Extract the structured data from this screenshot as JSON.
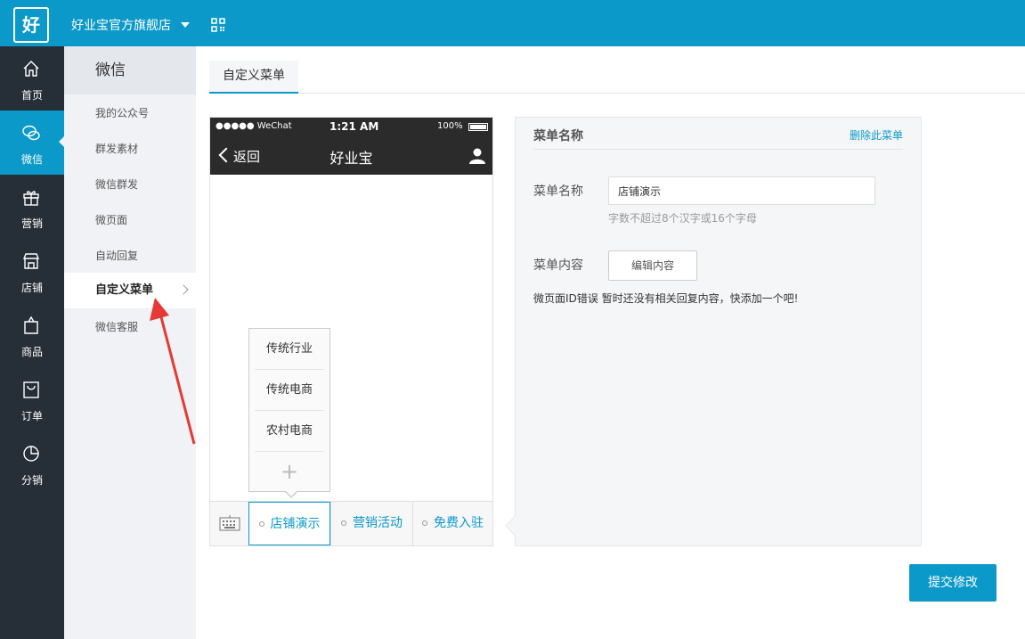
{
  "topbar": {
    "logo": "好",
    "shop_name": "好业宝官方旗舰店",
    "qr_icon": "qrcode-icon"
  },
  "left_nav": [
    {
      "label": "首页",
      "icon": "home-icon",
      "active": false
    },
    {
      "label": "微信",
      "icon": "wechat-icon",
      "active": true
    },
    {
      "label": "营销",
      "icon": "gift-icon",
      "active": false
    },
    {
      "label": "店铺",
      "icon": "store-icon",
      "active": false
    },
    {
      "label": "商品",
      "icon": "bag-icon",
      "active": false
    },
    {
      "label": "订单",
      "icon": "order-icon",
      "active": false
    },
    {
      "label": "分销",
      "icon": "pie-chart-icon",
      "active": false
    }
  ],
  "sub_nav": {
    "title": "微信",
    "items": [
      {
        "label": "我的公众号",
        "active": false
      },
      {
        "label": "群发素材",
        "active": false
      },
      {
        "label": "微信群发",
        "active": false
      },
      {
        "label": "微页面",
        "active": false
      },
      {
        "label": "自动回复",
        "active": false
      },
      {
        "label": "自定义菜单",
        "active": true
      },
      {
        "label": "微信客服",
        "active": false
      }
    ]
  },
  "tabs": [
    {
      "label": "自定义菜单",
      "active": true
    }
  ],
  "phone": {
    "carrier": "●●●●● WeChat",
    "time": "1:21 AM",
    "battery": "100%",
    "back_label": "返回",
    "title": "好业宝",
    "submenu": [
      "传统行业",
      "传统电商",
      "农村电商"
    ],
    "submenu_add": "+",
    "menu": [
      {
        "label": "店铺演示",
        "active": true
      },
      {
        "label": "营销活动",
        "active": false
      },
      {
        "label": "免费入驻",
        "active": false
      }
    ]
  },
  "panel": {
    "title": "菜单名称",
    "delete_link": "删除此菜单",
    "name_label": "菜单名称",
    "name_value": "店铺演示",
    "hint": "字数不超过8个汉字或16个字母",
    "content_label": "菜单内容",
    "edit_button": "编辑内容",
    "error_text": "微页面ID错误 暂时还没有相关回复内容，快添加一个吧!"
  },
  "submit_button": "提交修改",
  "colors": {
    "accent": "#0b99c9",
    "nav_dark": "#262e38",
    "annotation": "#e53935"
  }
}
